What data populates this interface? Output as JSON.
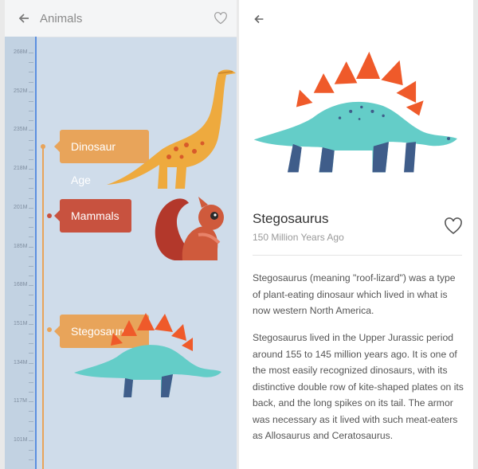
{
  "left": {
    "title": "Animals",
    "scale_labels": [
      "268M",
      "252M",
      "235M",
      "218M",
      "201M",
      "185M",
      "168M",
      "151M",
      "134M",
      "117M",
      "101M"
    ],
    "tags": {
      "dinosaur_age": "Dinosaur Age",
      "mammals": "Mammals",
      "stegosaurus": "Stegosaurus"
    }
  },
  "detail": {
    "name": "Stegosaurus",
    "subtitle": "150 Million Years Ago",
    "paragraph1": "Stegosaurus (meaning \"roof-lizard\") was a type of plant-eating dinosaur which lived in what is now western North America.",
    "paragraph2": "Stegosaurus lived in the Upper Jurassic period around 155 to 145 million years ago. It is one of the most easily recognized dinosaurs, with its distinctive double row of kite-shaped plates on its back, and the long spikes on its tail. The armor was necessary as it lived with such meat-eaters as Allosaurus and Ceratosaurus."
  },
  "colors": {
    "orange": "#e8a45a",
    "red": "#c8523f",
    "teal": "#64cdc8",
    "navy": "#3f5d8a",
    "blue_line": "#5b8fe0"
  },
  "icons": {
    "back": "arrow-left-icon",
    "favorite": "heart-outline-icon"
  }
}
